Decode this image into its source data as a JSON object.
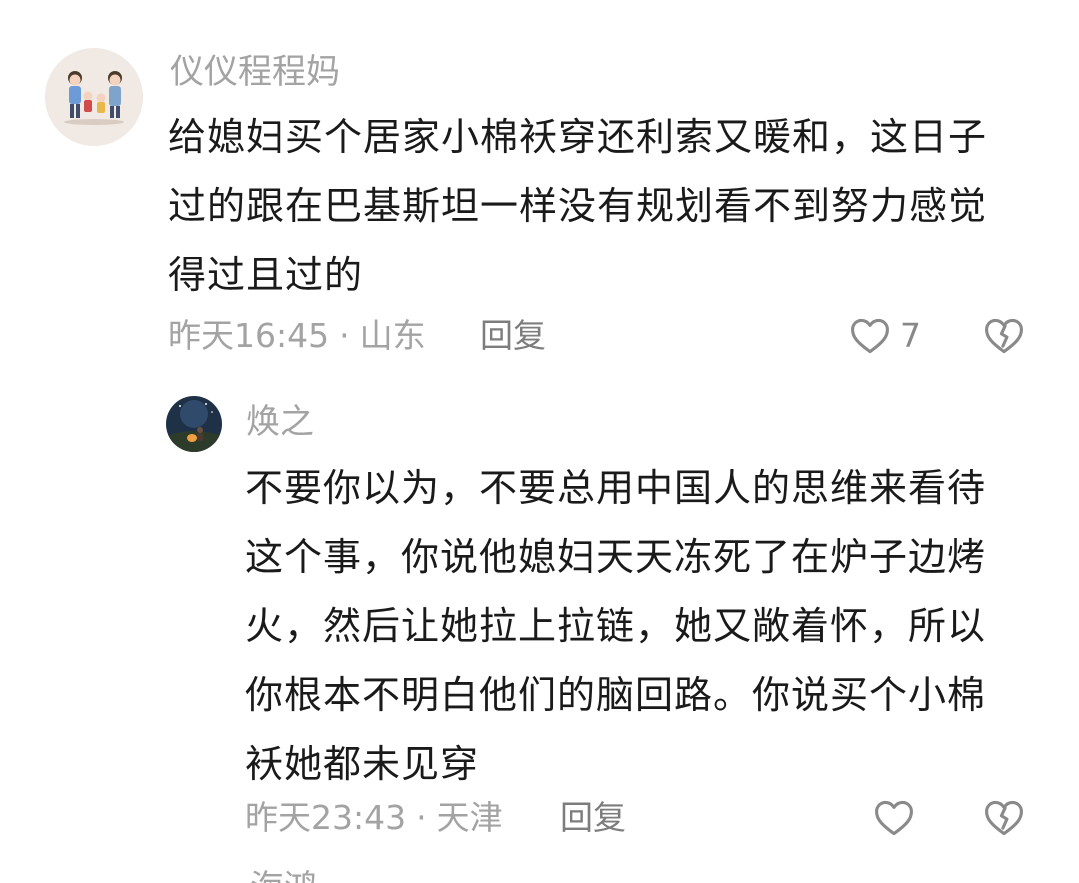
{
  "comments": [
    {
      "username": "仪仪程程妈",
      "lines": [
        "给媳妇买个居家小棉袄穿还利索又暖和，这日子",
        "过的跟在巴基斯坦一样没有规划看不到努力感觉",
        "得过且过的"
      ],
      "time": "昨天16:45",
      "location": "山东",
      "reply_label": "回复",
      "likes": "7"
    },
    {
      "username": "焕之",
      "lines": [
        "不要你以为，不要总用中国人的思维来看待",
        "这个事，你说他媳妇天天冻死了在炉子边烤",
        "火，然后让她拉上拉链，她又敞着怀，所以",
        "你根本不明白他们的脑回路。你说买个小棉",
        "袄她都未见穿"
      ],
      "time": "昨天23:43",
      "location": "天津",
      "reply_label": "回复",
      "likes": ""
    }
  ],
  "separator": "·",
  "next_username_partial": "海鸿",
  "colors": {
    "text_primary": "#1a1a1a",
    "text_secondary": "#a3a3a3",
    "icon": "#8a8a8a"
  },
  "icons": {
    "like": "heart-icon",
    "dislike": "broken-heart-icon"
  }
}
